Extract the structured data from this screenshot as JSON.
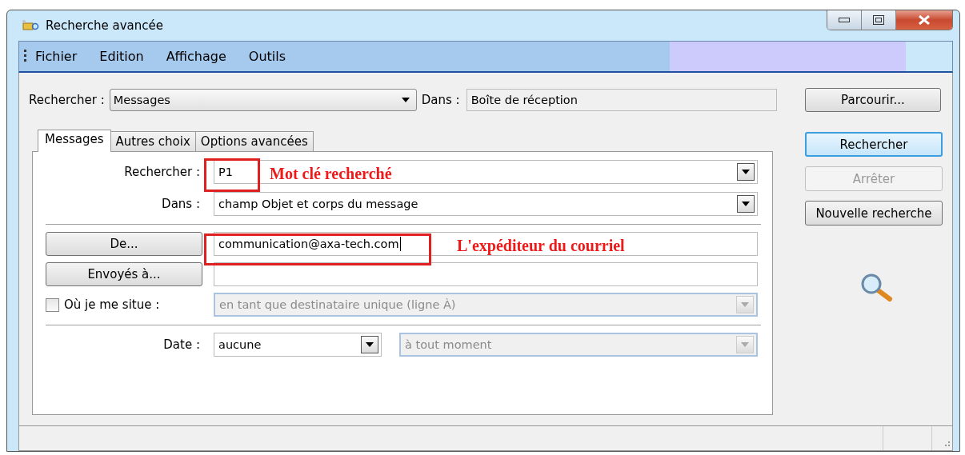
{
  "window": {
    "title": "Recherche avancée"
  },
  "menu": [
    "Fichier",
    "Edition",
    "Affichage",
    "Outils"
  ],
  "search_bar": {
    "label": "Rechercher :",
    "value": "Messages",
    "in_label": "Dans :",
    "in_value": "Boîte de réception",
    "browse_button": "Parcourir..."
  },
  "tabs": [
    {
      "label": "Messages",
      "selected": true
    },
    {
      "label": "Autres choix",
      "selected": false
    },
    {
      "label": "Options avancées",
      "selected": false
    }
  ],
  "keyword": {
    "label": "Rechercher :",
    "value": "P1",
    "annotation": "Mot clé recherché"
  },
  "scope": {
    "label": "Dans :",
    "value": "champ Objet et corps du message"
  },
  "from": {
    "button": "De...",
    "value": "communication@axa-tech.com",
    "annotation": "L'expéditeur du courriel"
  },
  "to": {
    "button": "Envoyés à..."
  },
  "location": {
    "label": "Où je me situe :",
    "checked": false,
    "value": "en tant que destinataire unique (ligne À)",
    "disabled": true
  },
  "date": {
    "label": "Date :",
    "value": "aucune",
    "range": "à tout moment",
    "range_disabled": true
  },
  "actions": [
    {
      "label": "Rechercher",
      "disabled": false,
      "focused": true
    },
    {
      "label": "Arrêter",
      "disabled": true,
      "focused": false
    },
    {
      "label": "Nouvelle recherche",
      "disabled": false,
      "focused": false
    }
  ]
}
